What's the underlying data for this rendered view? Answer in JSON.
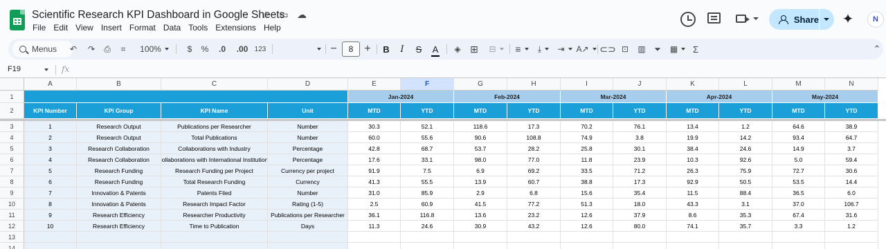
{
  "header": {
    "doc_title": "Scientific Research KPI Dashboard in Google Sheets",
    "menu": [
      "File",
      "Edit",
      "View",
      "Insert",
      "Format",
      "Data",
      "Tools",
      "Extensions",
      "Help"
    ],
    "share_label": "Share",
    "avatar_initial": "N"
  },
  "toolbar": {
    "menus_label": "Menus",
    "zoom": "100%",
    "currency": "$",
    "percent": "%",
    "dec_decrease": ".0",
    "dec_increase": ".00",
    "number_format": "123",
    "font_size": "8",
    "bold": "B",
    "italic": "I",
    "text_color": "A",
    "functions": "Σ"
  },
  "formula_bar": {
    "cell_ref": "F19",
    "fx": "fx",
    "value": ""
  },
  "sheet": {
    "column_letters": [
      "A",
      "B",
      "C",
      "D",
      "E",
      "F",
      "G",
      "H",
      "I",
      "J",
      "K",
      "L",
      "M",
      "N"
    ],
    "row_numbers": [
      "1",
      "2",
      "3",
      "4",
      "5",
      "6",
      "7",
      "8",
      "9",
      "10",
      "11",
      "12",
      "13",
      "14"
    ],
    "months": [
      "Jan-2024",
      "Feb-2024",
      "Mar-2024",
      "Apr-2024",
      "May-2024"
    ],
    "headers": [
      "KPI Number",
      "KPI Group",
      "KPI Name",
      "Unit"
    ],
    "period_labels": [
      "MTD",
      "YTD"
    ],
    "kpis": [
      {
        "num": "1",
        "group": "Research Output",
        "name": "Publications per Researcher",
        "unit": "Number",
        "values": [
          "30.3",
          "52.1",
          "118.6",
          "17.3",
          "70.2",
          "76.1",
          "13.4",
          "1.2",
          "64.6",
          "38.9"
        ]
      },
      {
        "num": "2",
        "group": "Research Output",
        "name": "Total Publications",
        "unit": "Number",
        "values": [
          "60.0",
          "55.6",
          "90.6",
          "108.8",
          "74.9",
          "3.8",
          "19.9",
          "14.2",
          "93.4",
          "64.7"
        ]
      },
      {
        "num": "3",
        "group": "Research Collaboration",
        "name": "Collaborations with Industry",
        "unit": "Percentage",
        "values": [
          "42.8",
          "68.7",
          "53.7",
          "28.2",
          "25.8",
          "30.1",
          "38.4",
          "24.6",
          "14.9",
          "3.7"
        ]
      },
      {
        "num": "4",
        "group": "Research Collaboration",
        "name": "Collaborations with International Institutions",
        "unit": "Percentage",
        "values": [
          "17.6",
          "33.1",
          "98.0",
          "77.0",
          "11.8",
          "23.9",
          "10.3",
          "92.6",
          "5.0",
          "59.4"
        ]
      },
      {
        "num": "5",
        "group": "Research Funding",
        "name": "Research Funding per Project",
        "unit": "Currency per project",
        "values": [
          "91.9",
          "7.5",
          "6.9",
          "69.2",
          "33.5",
          "71.2",
          "26.3",
          "75.9",
          "72.7",
          "30.6"
        ]
      },
      {
        "num": "6",
        "group": "Research Funding",
        "name": "Total Research Funding",
        "unit": "Currency",
        "values": [
          "41.3",
          "55.5",
          "13.9",
          "60.7",
          "38.8",
          "17.3",
          "92.9",
          "50.5",
          "53.5",
          "14.4"
        ]
      },
      {
        "num": "7",
        "group": "Innovation & Patents",
        "name": "Patents Filed",
        "unit": "Number",
        "values": [
          "31.0",
          "85.9",
          "2.9",
          "6.8",
          "15.6",
          "35.4",
          "11.5",
          "88.4",
          "36.5",
          "6.0"
        ]
      },
      {
        "num": "8",
        "group": "Innovation & Patents",
        "name": "Research Impact Factor",
        "unit": "Rating (1-5)",
        "values": [
          "2.5",
          "60.9",
          "41.5",
          "77.2",
          "51.3",
          "18.0",
          "43.3",
          "3.1",
          "37.0",
          "106.7"
        ]
      },
      {
        "num": "9",
        "group": "Research Efficiency",
        "name": "Researcher Productivity",
        "unit": "Publications per Researcher",
        "values": [
          "36.1",
          "116.8",
          "13.6",
          "23.2",
          "12.6",
          "37.9",
          "8.6",
          "35.3",
          "67.4",
          "31.6"
        ]
      },
      {
        "num": "10",
        "group": "Research Efficiency",
        "name": "Time to Publication",
        "unit": "Days",
        "values": [
          "11.3",
          "24.6",
          "30.9",
          "43.2",
          "12.6",
          "80.0",
          "74.1",
          "35.7",
          "3.3",
          "1.2"
        ]
      }
    ]
  },
  "colors": {
    "header_blue": "#1a9fd8",
    "month_blue": "#a6cdec",
    "info_fill": "#e8f0f9",
    "share_bg": "#c2e7ff",
    "sheets_green": "#0f9d58"
  }
}
